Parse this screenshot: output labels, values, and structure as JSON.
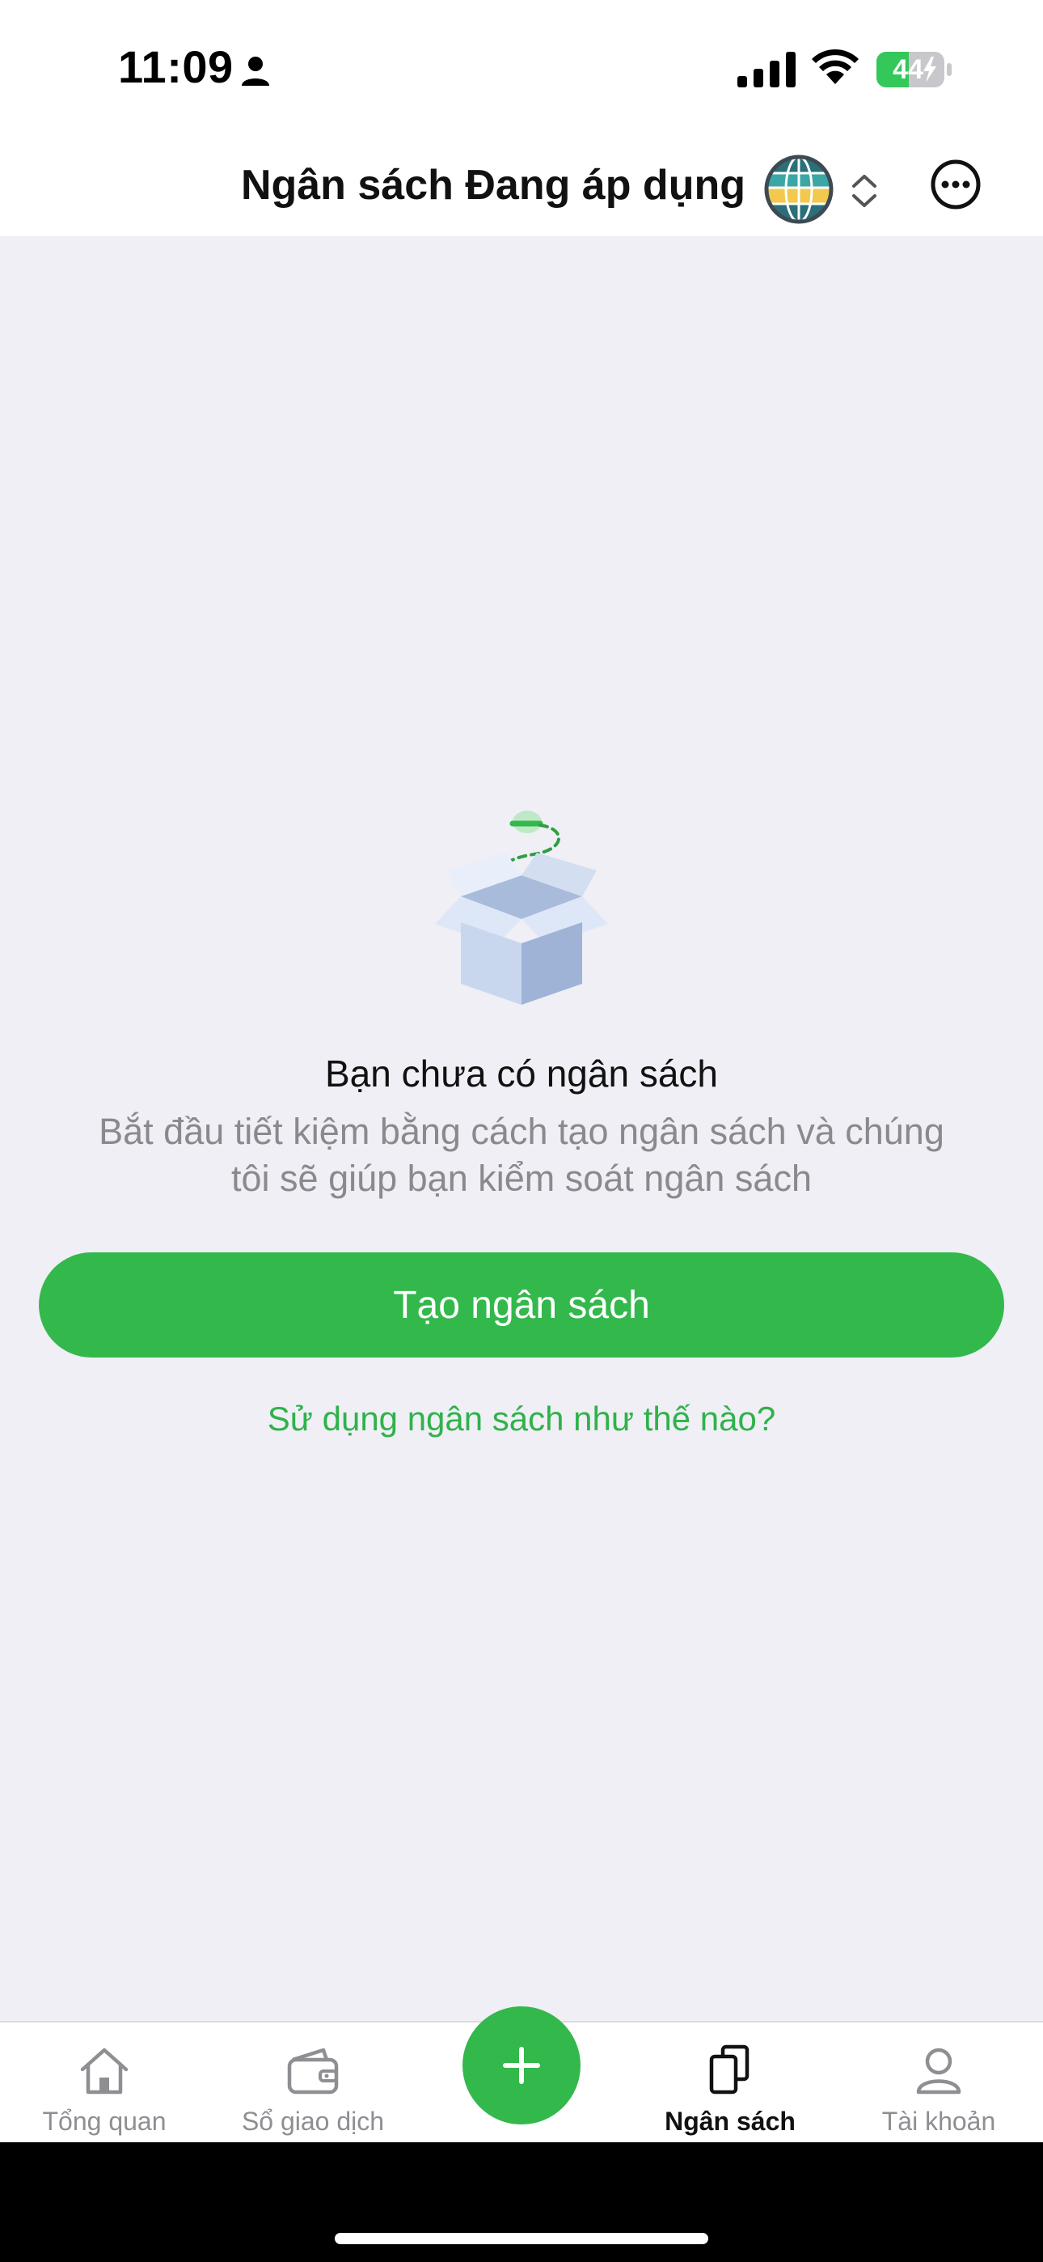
{
  "status_bar": {
    "time": "11:09",
    "battery_level": "44",
    "battery_percent": 44
  },
  "header": {
    "title": "Ngân sách Đang áp dụng"
  },
  "empty_state": {
    "title": "Bạn chưa có ngân sách",
    "description": "Bắt đầu tiết kiệm bằng cách tạo ngân sách và chúng tôi sẽ giúp bạn kiểm soát ngân sách"
  },
  "actions": {
    "create_label": "Tạo ngân sách",
    "howto_label": "Sử dụng ngân sách như thế nào?"
  },
  "tabs": [
    {
      "label": "Tổng quan",
      "icon": "home-icon",
      "active": false
    },
    {
      "label": "Sổ giao dịch",
      "icon": "wallet-icon",
      "active": false
    },
    {
      "label": "Ngân sách",
      "icon": "budget-icon",
      "active": true
    },
    {
      "label": "Tài khoản",
      "icon": "account-icon",
      "active": false
    }
  ],
  "colors": {
    "accent_green": "#33b84c",
    "background": "#efeff5",
    "text_secondary": "#8a8a8e"
  }
}
